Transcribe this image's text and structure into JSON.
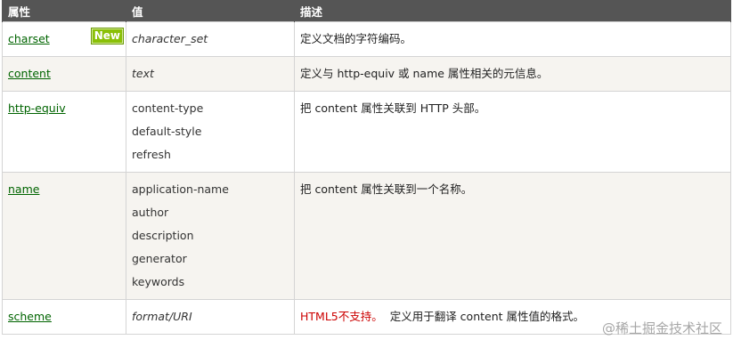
{
  "headers": {
    "attr": "属性",
    "value": "值",
    "desc": "描述"
  },
  "rows": [
    {
      "attr": "charset",
      "badge": "New",
      "values": [
        "character_set"
      ],
      "desc": "定义文档的字符编码。"
    },
    {
      "attr": "content",
      "values": [
        "text"
      ],
      "desc": "定义与 http-equiv 或 name 属性相关的元信息。"
    },
    {
      "attr": "http-equiv",
      "values": [
        "content-type",
        "default-style",
        "refresh"
      ],
      "desc": "把 content 属性关联到 HTTP 头部。"
    },
    {
      "attr": "name",
      "values": [
        "application-name",
        "author",
        "description",
        "generator",
        "keywords"
      ],
      "desc": "把 content 属性关联到一个名称。"
    },
    {
      "attr": "scheme",
      "values": [
        "format/URI"
      ],
      "desc_red": "HTML5不支持。",
      "desc": "定义用于翻译 content 属性值的格式。"
    }
  ],
  "watermark": "@稀土掘金技术社区",
  "colors": {
    "header_bg": "#555555",
    "link": "#006400",
    "badge": "#8ac007",
    "alt_row": "#f6f4f0",
    "warn": "#cc0000"
  }
}
